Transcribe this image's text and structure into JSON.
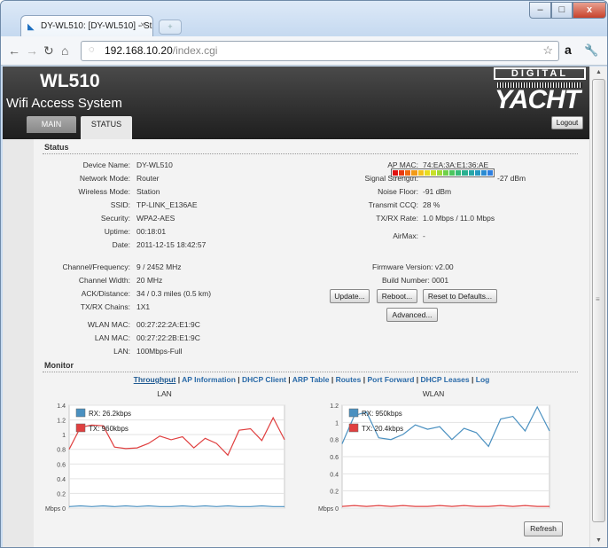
{
  "browser": {
    "tab_title": "DY-WL510: [DY-WL510] - St",
    "tab_close": "×",
    "url_host": "192.168.10.20",
    "url_path": "/index.cgi",
    "window_buttons": {
      "minimize": "–",
      "maximize": "□",
      "close": "x"
    }
  },
  "header": {
    "model": "WL510",
    "subtitle": "Wifi Access System",
    "logo_top": "DIGITAL",
    "logo_bottom": "YACHT",
    "logout_label": "Logout",
    "tabs": [
      {
        "label": "MAIN"
      },
      {
        "label": "STATUS"
      }
    ]
  },
  "status": {
    "section_title": "Status",
    "left": [
      {
        "label": "Device Name:",
        "value": "DY-WL510"
      },
      {
        "label": "Network Mode:",
        "value": "Router"
      },
      {
        "label": "Wireless Mode:",
        "value": "Station"
      },
      {
        "label": "SSID:",
        "value": "TP-LINK_E136AE"
      },
      {
        "label": "Security:",
        "value": "WPA2-AES"
      },
      {
        "label": "Uptime:",
        "value": "00:18:01"
      },
      {
        "label": "Date:",
        "value": "2011-12-15 18:42:57"
      }
    ],
    "left2": [
      {
        "label": "Channel/Frequency:",
        "value": "9 / 2452 MHz"
      },
      {
        "label": "Channel Width:",
        "value": "20 MHz"
      },
      {
        "label": "ACK/Distance:",
        "value": "34 / 0.3 miles (0.5 km)"
      },
      {
        "label": "TX/RX Chains:",
        "value": "1X1"
      }
    ],
    "left3": [
      {
        "label": "WLAN MAC:",
        "value": "00:27:22:2A:E1:9C"
      },
      {
        "label": "LAN MAC:",
        "value": "00:27:22:2B:E1:9C"
      },
      {
        "label": "LAN:",
        "value": "100Mbps-Full"
      }
    ],
    "right": [
      {
        "label": "AP MAC:",
        "value": "74:EA:3A:E1:36:AE"
      },
      {
        "label": "Signal Strength:",
        "value": "-27 dBm"
      },
      {
        "label": "Noise Floor:",
        "value": "-91 dBm"
      },
      {
        "label": "Transmit CCQ:",
        "value": "28 %"
      },
      {
        "label": "TX/RX Rate:",
        "value": "1.0 Mbps / 11.0 Mbps"
      },
      {
        "label": "AirMax:",
        "value": "-"
      }
    ],
    "signal_segments": 16,
    "signal_colors": [
      "#e01010",
      "#e83a10",
      "#ef6a12",
      "#f29a18",
      "#f5c21d",
      "#e8dc1f",
      "#c8e02a",
      "#9fd83a",
      "#6fd04a",
      "#4cc65e",
      "#36bb78",
      "#2ab090",
      "#26a6a8",
      "#2699c0",
      "#2a8bd2",
      "#2e7fe0"
    ],
    "firmware": "Firmware Version: v2.00",
    "build": "Build Number: 0001",
    "buttons": {
      "update": "Update...",
      "reboot": "Reboot...",
      "reset": "Reset to Defaults...",
      "advanced": "Advanced..."
    }
  },
  "monitor": {
    "section_title": "Monitor",
    "links": [
      "Throughput",
      "AP Information",
      "DHCP Client",
      "ARP Table",
      "Routes",
      "Port Forward",
      "DHCP Leases",
      "Log"
    ],
    "refresh_label": "Refresh"
  },
  "chart_data": [
    {
      "type": "line",
      "title": "LAN",
      "ylabel": "Mbps",
      "ylim": [
        0,
        1.4
      ],
      "yticks": [
        "Mbps 0",
        "0.2",
        "0.4",
        "0.6",
        "0.8",
        "1",
        "1.2",
        "1.4"
      ],
      "grid": true,
      "legend": "top-left",
      "series": [
        {
          "name": "RX: 26.2kbps",
          "color": "#4a90c0",
          "values": [
            0.02,
            0.03,
            0.02,
            0.03,
            0.02,
            0.03,
            0.02,
            0.03,
            0.02,
            0.02,
            0.03,
            0.02,
            0.03,
            0.02,
            0.03,
            0.02,
            0.02,
            0.03,
            0.02,
            0.02
          ]
        },
        {
          "name": "TX: 960kbps",
          "color": "#e04040",
          "values": [
            0.8,
            1.1,
            1.13,
            1.12,
            0.83,
            0.81,
            0.82,
            0.88,
            0.98,
            0.93,
            0.97,
            0.82,
            0.95,
            0.88,
            0.72,
            1.06,
            1.08,
            0.92,
            1.23,
            0.93
          ]
        }
      ]
    },
    {
      "type": "line",
      "title": "WLAN",
      "ylabel": "Mbps",
      "ylim": [
        0,
        1.2
      ],
      "yticks": [
        "Mbps 0",
        "0.2",
        "0.4",
        "0.6",
        "0.8",
        "1",
        "1.2"
      ],
      "grid": true,
      "legend": "top-left",
      "series": [
        {
          "name": "RX: 950kbps",
          "color": "#4a90c0",
          "values": [
            0.75,
            1.08,
            1.12,
            0.82,
            0.8,
            0.86,
            0.97,
            0.92,
            0.95,
            0.8,
            0.93,
            0.88,
            0.72,
            1.04,
            1.07,
            0.9,
            1.18,
            0.9
          ]
        },
        {
          "name": "TX: 20.4kbps",
          "color": "#e04040",
          "values": [
            0.02,
            0.03,
            0.02,
            0.03,
            0.02,
            0.03,
            0.02,
            0.02,
            0.03,
            0.02,
            0.03,
            0.02,
            0.02,
            0.03,
            0.02,
            0.03,
            0.02,
            0.02
          ]
        }
      ]
    }
  ]
}
